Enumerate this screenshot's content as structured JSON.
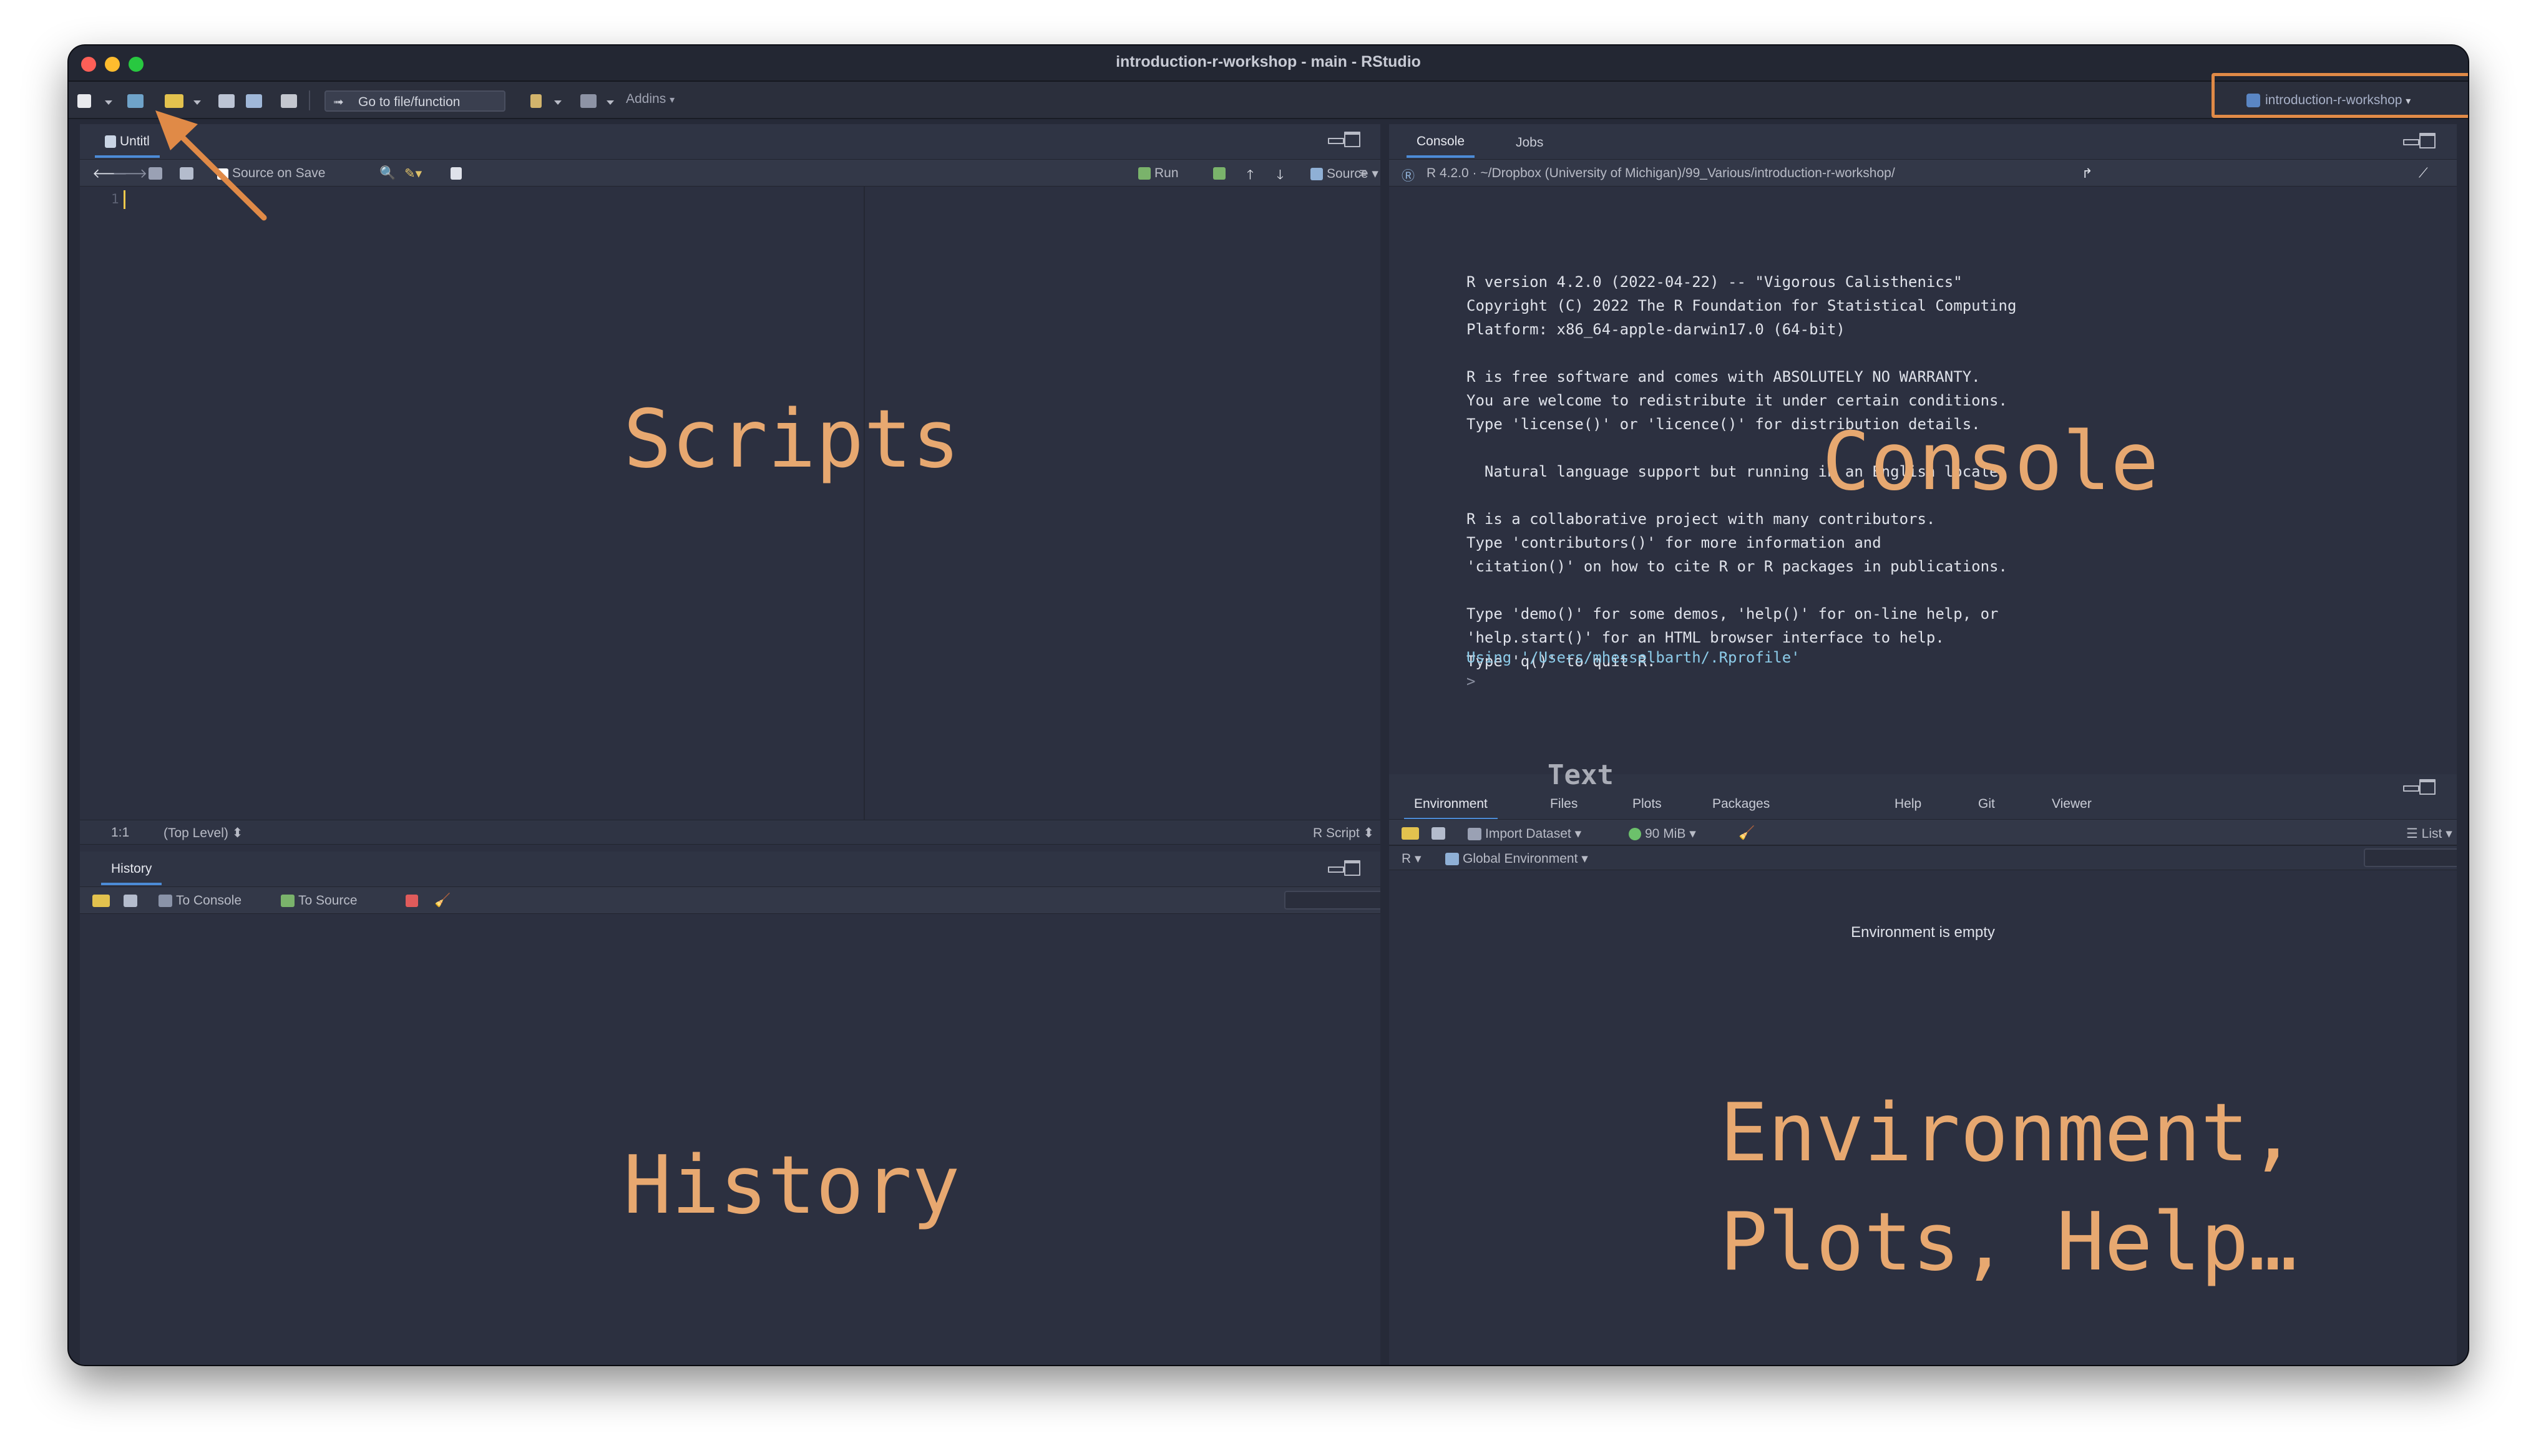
{
  "window": {
    "title": "introduction-r-workshop - main - RStudio"
  },
  "toolbar": {
    "goto_placeholder": "Go to file/function",
    "addins": "Addins",
    "project": "introduction-r-workshop"
  },
  "source": {
    "tab": "Untitl",
    "source_on_save": "Source on Save",
    "run": "Run",
    "source": "Source",
    "line_number": "1",
    "position": "1:1",
    "scope": "(Top Level)",
    "file_type": "R Script",
    "label": "Scripts"
  },
  "history": {
    "tab": "History",
    "to_console": "To Console",
    "to_source": "To Source",
    "label": "History"
  },
  "console": {
    "tabs": [
      "Console",
      "Jobs"
    ],
    "path": "R 4.2.0 · ~/Dropbox (University of Michigan)/99_Various/introduction-r-workshop/",
    "lines": [
      "R version 4.2.0 (2022-04-22) -- \"Vigorous Calisthenics\"",
      "Copyright (C) 2022 The R Foundation for Statistical Computing",
      "Platform: x86_64-apple-darwin17.0 (64-bit)",
      "",
      "R is free software and comes with ABSOLUTELY NO WARRANTY.",
      "You are welcome to redistribute it under certain conditions.",
      "Type 'license()' or 'licence()' for distribution details.",
      "",
      "  Natural language support but running in an English locale",
      "",
      "R is a collaborative project with many contributors.",
      "Type 'contributors()' for more information and",
      "'citation()' on how to cite R or R packages in publications.",
      "",
      "Type 'demo()' for some demos, 'help()' for on-line help, or",
      "'help.start()' for an HTML browser interface to help.",
      "Type 'q()' to quit R.",
      ""
    ],
    "rprofile": "Using '/Users/mhesselbarth/.Rprofile'",
    "prompt": ">",
    "label": "Console"
  },
  "environment": {
    "tabs": [
      "Environment",
      "Files",
      "Plots",
      "Packages",
      "Help",
      "Git",
      "Viewer"
    ],
    "import_dataset": "Import Dataset",
    "memory": "90 MiB",
    "list": "List",
    "lang": "R",
    "scope": "Global Environment",
    "empty": "Environment is empty",
    "text_label": "Text",
    "label_line1": "Environment,",
    "label_line2": "Plots, Help…"
  },
  "colors": {
    "accent": "#e08a47",
    "background": "#2c3040",
    "label": "#e7a870"
  }
}
